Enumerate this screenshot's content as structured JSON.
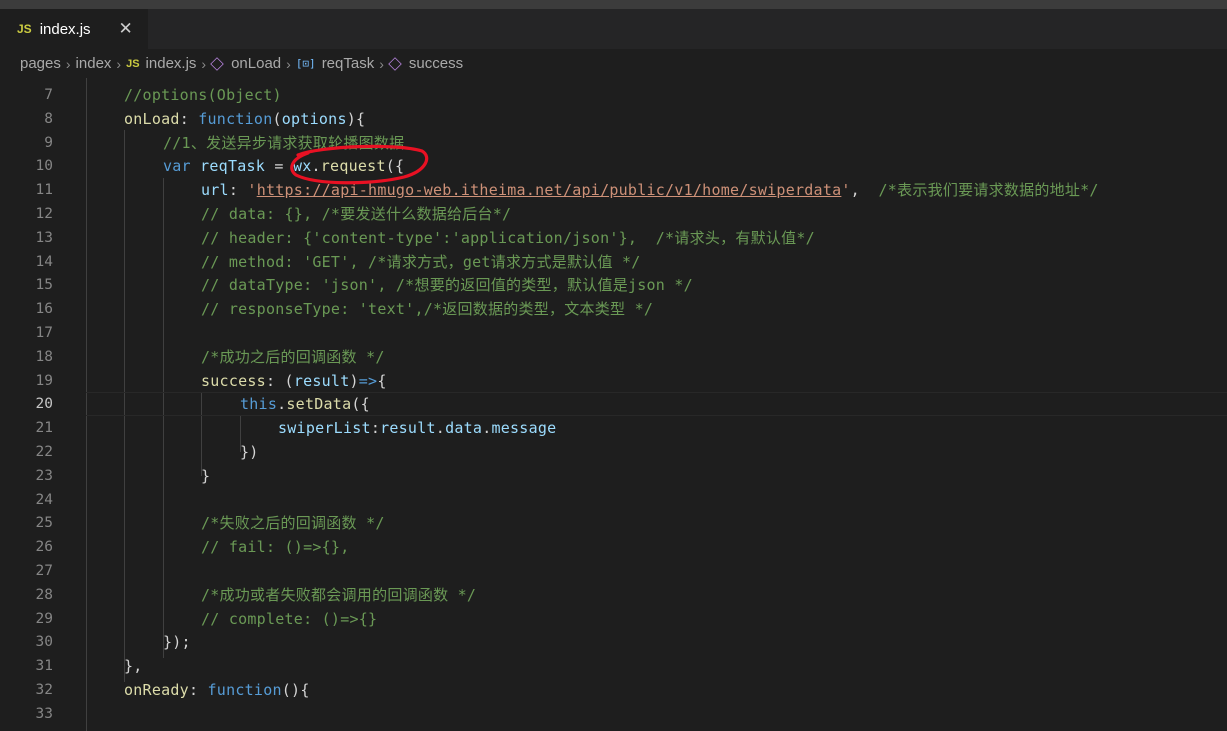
{
  "tab": {
    "icon": "JS",
    "name": "index.js",
    "close": "✕"
  },
  "breadcrumb": {
    "pages": "pages",
    "index": "index",
    "file_icon": "JS",
    "file": "index.js",
    "onload": "onLoad",
    "var_icon": "[⊡]",
    "reqtask": "reqTask",
    "success": "success"
  },
  "editor": {
    "active_line": "20",
    "lines": [
      {
        "n": "7",
        "text": "//options(Object)"
      },
      {
        "n": "8",
        "text": "onLoad: function(options){"
      },
      {
        "n": "9",
        "text": "//1、发送异步请求获取轮播图数据"
      },
      {
        "n": "10",
        "text": "var reqTask = wx.request({"
      },
      {
        "n": "11",
        "text": "url: 'https://api-hmugo-web.itheima.net/api/public/v1/home/swiperdata',  /*表示我们要请求数据的地址*/"
      },
      {
        "n": "12",
        "text": "// data: {}, /*要发送什么数据给后台*/"
      },
      {
        "n": "13",
        "text": "// header: {'content-type':'application/json'},  /*请求头，有默认值*/"
      },
      {
        "n": "14",
        "text": "// method: 'GET', /*请求方式，get请求方式是默认值 */"
      },
      {
        "n": "15",
        "text": "// dataType: 'json', /*想要的返回值的类型，默认值是json */"
      },
      {
        "n": "16",
        "text": "// responseType: 'text',/*返回数据的类型，文本类型 */"
      },
      {
        "n": "17",
        "text": ""
      },
      {
        "n": "18",
        "text": "/*成功之后的回调函数 */"
      },
      {
        "n": "19",
        "text": "success: (result)=>{"
      },
      {
        "n": "20",
        "text": "this.setData({"
      },
      {
        "n": "21",
        "text": "swiperList:result.data.message"
      },
      {
        "n": "22",
        "text": "})"
      },
      {
        "n": "23",
        "text": "}"
      },
      {
        "n": "24",
        "text": ""
      },
      {
        "n": "25",
        "text": "/*失败之后的回调函数 */"
      },
      {
        "n": "26",
        "text": "// fail: ()=>{},"
      },
      {
        "n": "27",
        "text": ""
      },
      {
        "n": "28",
        "text": "/*成功或者失败都会调用的回调函数 */"
      },
      {
        "n": "29",
        "text": "// complete: ()=>{}"
      },
      {
        "n": "30",
        "text": "});"
      },
      {
        "n": "31",
        "text": "},"
      },
      {
        "n": "32",
        "text": "onReady: function(){"
      },
      {
        "n": "33",
        "text": ""
      }
    ]
  },
  "colors": {
    "background": "#1e1e1e",
    "keyword": "#569cd6",
    "function": "#dcdcaa",
    "property": "#9cdcfe",
    "string": "#ce9178",
    "comment": "#6a9955",
    "annotation": "#e81123"
  },
  "icons": [
    "js-file-icon",
    "close-icon",
    "chevron-right-icon",
    "method-cube-icon",
    "variable-icon"
  ]
}
